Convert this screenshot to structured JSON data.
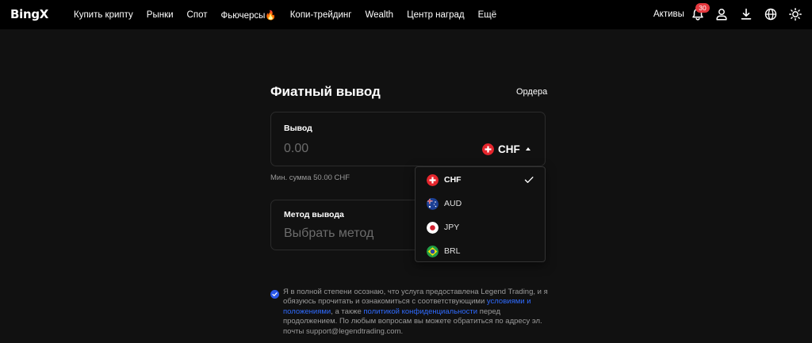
{
  "brand": {
    "logo_text": "BingX"
  },
  "nav": {
    "items": [
      "Купить крипту",
      "Рынки",
      "Спот",
      "Фьючерсы🔥",
      "Копи-трейдинг",
      "Wealth",
      "Центр наград",
      "Ещё"
    ],
    "assets_label": "Активы",
    "notification_count": "30"
  },
  "page": {
    "title": "Фиатный вывод",
    "orders_link": "Ордера"
  },
  "withdraw_card": {
    "label": "Вывод",
    "amount_placeholder": "0.00",
    "selected_currency": "CHF"
  },
  "min_sum_text": "Мин. сумма 50.00 CHF",
  "method_card": {
    "label": "Метод вывода",
    "placeholder": "Выбрать метод"
  },
  "currency_dropdown": {
    "options": [
      "CHF",
      "AUD",
      "JPY",
      "BRL"
    ],
    "selected": "CHF"
  },
  "consent": {
    "text_1": "Я в полной степени осознаю, что услуга предоставлена Legend Trading, и я обязуюсь прочитать и ознакомиться с соответствующими ",
    "link_terms": "условиями и положениями",
    "text_2": ", а также ",
    "link_privacy": "политикой конфиденциальности",
    "text_3": " перед продолжением. По любым вопросам вы можете обратиться по адресу эл. почты support@legendtrading.com."
  },
  "colors": {
    "background": "#111111",
    "nav_background": "#000000",
    "accent_blue": "#2a57e8",
    "link_blue": "#2f6bff",
    "badge_red": "#e5393f"
  },
  "icons": {
    "bell": "bell-icon",
    "user": "user-icon",
    "download": "download-icon",
    "globe": "globe-icon",
    "theme": "sun-icon",
    "check": "check-icon"
  }
}
